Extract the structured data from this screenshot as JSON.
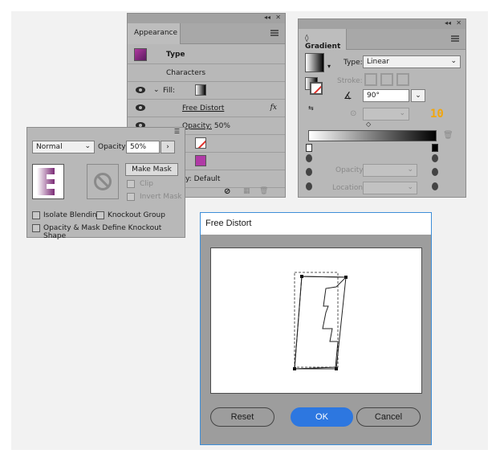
{
  "appearance": {
    "tab": "Appearance",
    "rows": {
      "type": "Type",
      "characters": "Characters",
      "fill": "Fill:",
      "free_distort": "Free Distort",
      "fx": "fx",
      "opacity_label": "Opacity:",
      "opacity_value": "50%",
      "default_partial": "y: Default"
    }
  },
  "transparency": {
    "blend_mode": "Normal",
    "opacity_label": "Opacity:",
    "opacity_value": "50%",
    "make_mask": "Make Mask",
    "clip": "Clip",
    "invert_mask": "Invert Mask",
    "isolate_blending": "Isolate Blending",
    "knockout_group": "Knockout Group",
    "opacity_mask_knockout": "Opacity & Mask Define Knockout Shape"
  },
  "gradient": {
    "tab": "Gradient",
    "type_label": "Type:",
    "type_value": "Linear",
    "stroke_label": "Stroke:",
    "angle_value": "90°",
    "opacity_label": "Opacity:",
    "location_label": "Location:",
    "step_number": "10"
  },
  "free_distort_dialog": {
    "title": "Free Distort",
    "reset": "Reset",
    "ok": "OK",
    "cancel": "Cancel"
  },
  "colors": {
    "panel_bg": "#b8b8b8",
    "accent_blue": "#2d77e0",
    "step_badge": "#f2a60c",
    "fill_purple": "#8e2f86"
  }
}
